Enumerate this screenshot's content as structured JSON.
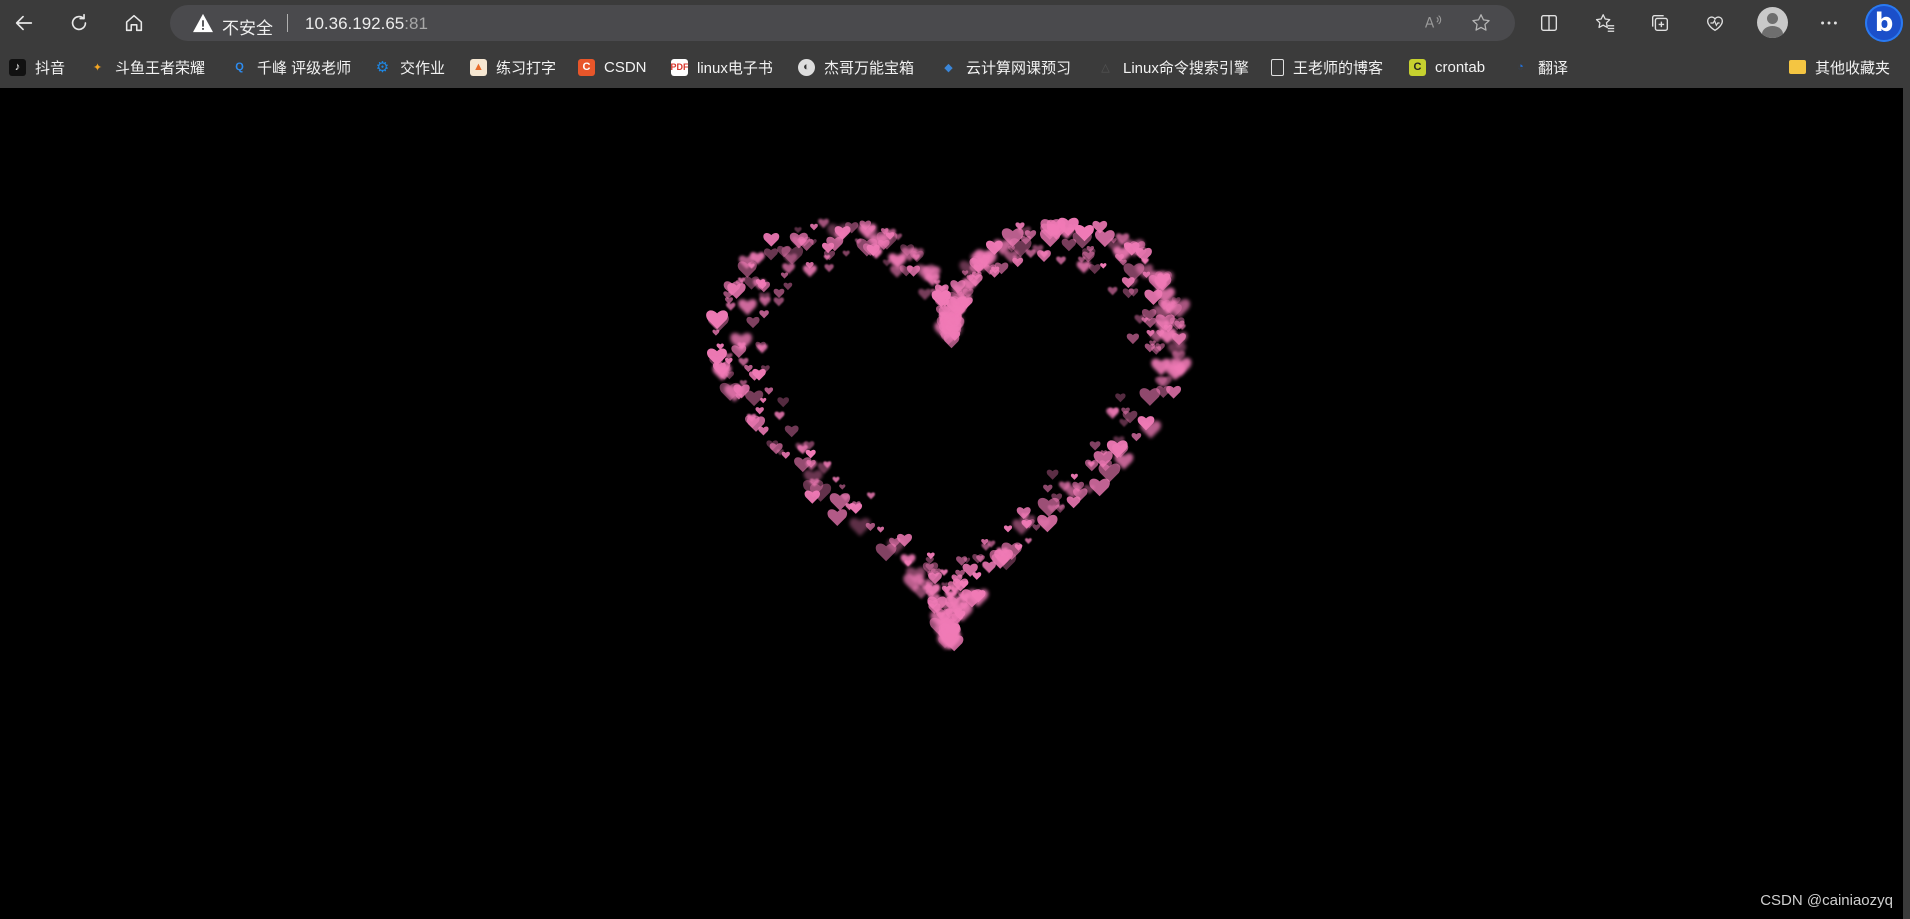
{
  "browser": {
    "security_label": "不安全",
    "url_host": "10.36.192.65",
    "url_port": ":81",
    "icons": [
      "back-icon",
      "refresh-icon",
      "home-icon",
      "warning-icon",
      "read-aloud-icon",
      "favorite-star-icon",
      "split-screen-icon",
      "favorites-icon",
      "collections-icon",
      "browser-essentials-icon",
      "profile-icon",
      "more-icon",
      "bing-icon"
    ],
    "bing_glyph": "b"
  },
  "bookmarks": [
    {
      "label": "抖音",
      "icon": "tiktok-icon",
      "color": "#111111",
      "glyph": "♪"
    },
    {
      "label": "斗鱼王者荣耀",
      "icon": "douyu-icon",
      "color": "#f5a623",
      "glyph": "✦"
    },
    {
      "label": "千峰 评级老师",
      "icon": "qianfeng-icon",
      "color": "#2d8cf0",
      "glyph": "Q"
    },
    {
      "label": "交作业",
      "icon": "gear-icon",
      "color": "#1e88e5",
      "glyph": "⚙"
    },
    {
      "label": "练习打字",
      "icon": "typing-icon",
      "color": "#e86b2a",
      "glyph": "▲"
    },
    {
      "label": "CSDN",
      "icon": "csdn-icon",
      "color": "#e8562a",
      "glyph": "C"
    },
    {
      "label": "linux电子书",
      "icon": "pdf-icon",
      "color": "#d9342b",
      "glyph": "P"
    },
    {
      "label": "杰哥万能宝箱",
      "icon": "toolbox-icon",
      "color": "#444444",
      "glyph": "◐"
    },
    {
      "label": "云计算网课预习",
      "icon": "cloud-icon",
      "color": "#3a86d9",
      "glyph": "◆"
    },
    {
      "label": "Linux命令搜索引擎",
      "icon": "linux-icon",
      "color": "#3b3b3b",
      "glyph": "△"
    },
    {
      "label": "王老师的博客",
      "icon": "page-icon",
      "color": "#3b3b3b",
      "glyph": "▯"
    },
    {
      "label": "crontab",
      "icon": "crontab-icon",
      "color": "#c6d12f",
      "glyph": "C"
    },
    {
      "label": "翻译",
      "icon": "translate-icon",
      "color": "#2470d6",
      "glyph": "◔"
    },
    {
      "label": "其他收藏夹",
      "icon": "folder-icon",
      "color": "#f4c542",
      "glyph": "▬"
    }
  ],
  "content": {
    "background": "#000000",
    "heart_color": "#f07ab6",
    "watermark": "CSDN @cainiaozyq"
  }
}
